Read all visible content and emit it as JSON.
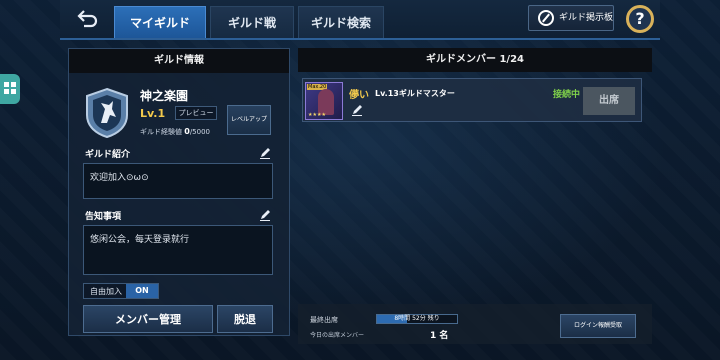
{
  "header": {
    "back_icon": "back-arrow-icon",
    "tabs": [
      {
        "label": "マイギルド",
        "active": true
      },
      {
        "label": "ギルド戦",
        "active": false
      },
      {
        "label": "ギルド検索",
        "active": false
      }
    ],
    "board_button": "ギルド掲示板",
    "help_label": "?"
  },
  "side": {
    "icon": "grid-icon",
    "color": "#3fa7a2"
  },
  "guild_info": {
    "header": "ギルド情報",
    "name": "神之楽園",
    "level": "Lv.1",
    "preview": "プレビュー",
    "exp_label": "ギルド経験値",
    "exp_current": "0",
    "exp_max": "/5000",
    "level_up": "レベルアップ",
    "intro_label": "ギルド紹介",
    "intro_text": "欢迎加入⊙ω⊙",
    "notice_label": "告知事項",
    "notice_text": "悠闲公会，每天登录就行",
    "auto_join_label": "自由加入",
    "auto_join_value": "ON",
    "manage_button": "メンバー管理",
    "leave_button": "脱退"
  },
  "members": {
    "header": "ギルドメンバー 1/24",
    "list": [
      {
        "name": "儚い",
        "level_role": "Lv.13ギルドマスター",
        "status": "接続中",
        "attend": "出席",
        "avatar_badge": "Max.20"
      }
    ]
  },
  "footer": {
    "last_attend_label": "最終出席",
    "timer_text": "8時間 52分 残り",
    "timer_fraction": 0.37,
    "today_label": "今日の出席メンバー",
    "today_count": "1 名",
    "reward_button": "ログイン報酬受取"
  },
  "colors": {
    "accent": "#2c6fb8",
    "gold": "#f2c94c",
    "online": "#7fd14a"
  }
}
